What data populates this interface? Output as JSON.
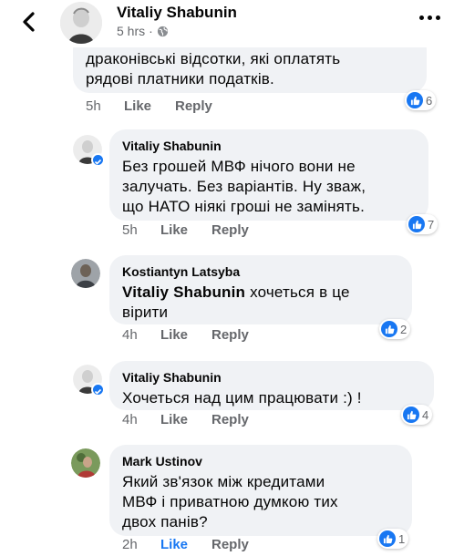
{
  "header": {
    "name": "Vitaliy Shabunin",
    "time": "5 hrs",
    "separator": "·"
  },
  "comments": [
    {
      "author": "",
      "text_lines": [
        "драконівські відсотки, які оплатять",
        "рядові платники податків."
      ],
      "time": "5h",
      "like": "Like",
      "reply": "Reply",
      "reactions": "6"
    },
    {
      "author": "Vitaliy Shabunin",
      "text_lines": [
        "Без грошей МВФ нічого вони не",
        "залучать. Без варіантів. Ну зваж,",
        "що НАТО ніякі гроші не замінять."
      ],
      "time": "5h",
      "like": "Like",
      "reply": "Reply",
      "reactions": "7"
    },
    {
      "author": "Kostiantyn Latsyba",
      "mention": "Vitaliy Shabunin",
      "text_line1_rest": " хочеться в це",
      "text_line2": "вірити",
      "time": "4h",
      "like": "Like",
      "reply": "Reply",
      "reactions": "2"
    },
    {
      "author": "Vitaliy Shabunin",
      "text_lines": [
        "Хочеться над цим працювати :) !"
      ],
      "time": "4h",
      "like": "Like",
      "reply": "Reply",
      "reactions": "4"
    },
    {
      "author": "Mark Ustinov",
      "text_lines": [
        "Який зв'язок між кредитами",
        "МВФ і приватною думкою тих",
        "двох панів?"
      ],
      "time": "2h",
      "like": "Like",
      "reply": "Reply",
      "reactions": "1"
    }
  ],
  "colors": {
    "accent": "#1877f2",
    "bubble": "#f0f2f5",
    "muted": "#65676b"
  }
}
